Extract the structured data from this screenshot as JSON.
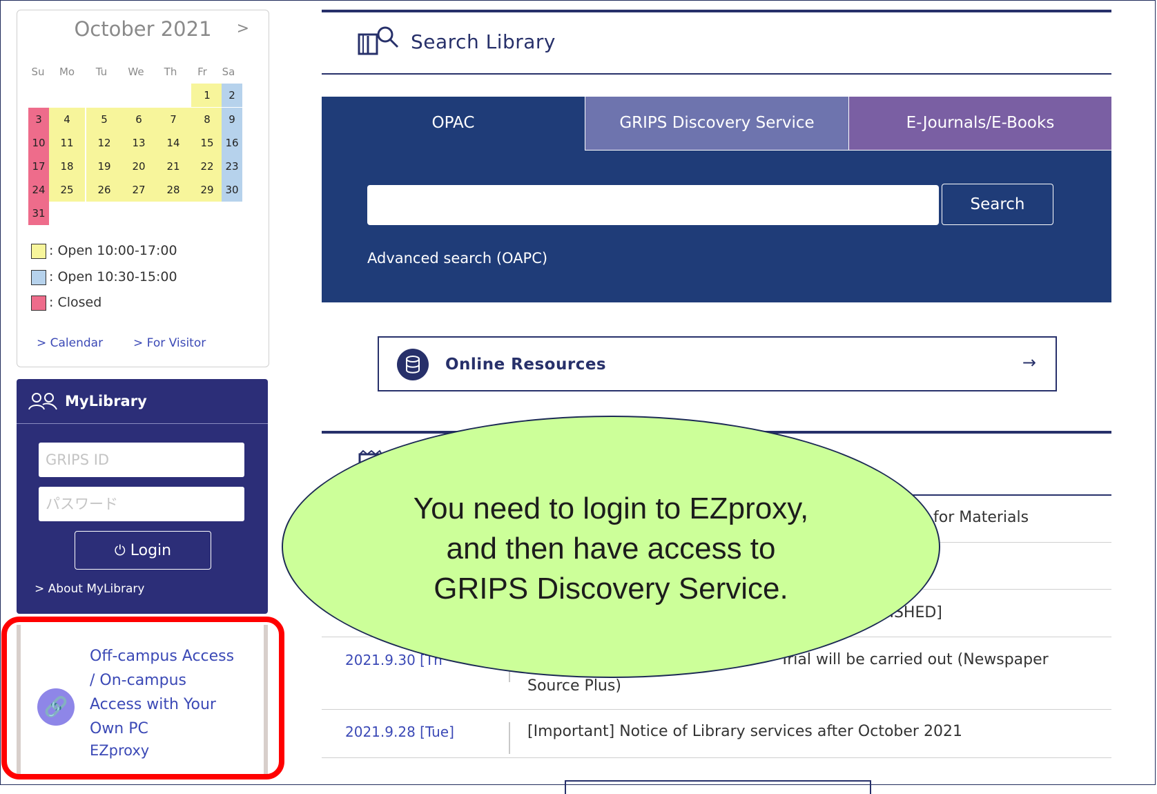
{
  "calendar": {
    "month_title": "October 2021",
    "next_label": ">",
    "weekdays": [
      "Su",
      "Mo",
      "Tu",
      "We",
      "Th",
      "Fr",
      "Sa"
    ],
    "legend": [
      {
        "label": ": Open 10:00-17:00",
        "color": "#f7f59b"
      },
      {
        "label": ": Open 10:30-15:00",
        "color": "#b6d2ec"
      },
      {
        "label": ": Closed",
        "color": "#ee6c8b"
      }
    ],
    "links": [
      "> Calendar",
      "> For Visitor"
    ],
    "days": [
      {
        "d": "1",
        "s": "y"
      },
      {
        "d": "2",
        "s": "b"
      },
      {
        "d": "3",
        "s": "r"
      },
      {
        "d": "4",
        "s": "y"
      },
      {
        "d": "5",
        "s": "y"
      },
      {
        "d": "6",
        "s": "y"
      },
      {
        "d": "7",
        "s": "y"
      },
      {
        "d": "8",
        "s": "y"
      },
      {
        "d": "9",
        "s": "b"
      },
      {
        "d": "10",
        "s": "r"
      },
      {
        "d": "11",
        "s": "y"
      },
      {
        "d": "12",
        "s": "y"
      },
      {
        "d": "13",
        "s": "y"
      },
      {
        "d": "14",
        "s": "y"
      },
      {
        "d": "15",
        "s": "y"
      },
      {
        "d": "16",
        "s": "b"
      },
      {
        "d": "17",
        "s": "r"
      },
      {
        "d": "18",
        "s": "y"
      },
      {
        "d": "19",
        "s": "y"
      },
      {
        "d": "20",
        "s": "y"
      },
      {
        "d": "21",
        "s": "y"
      },
      {
        "d": "22",
        "s": "y"
      },
      {
        "d": "23",
        "s": "b"
      },
      {
        "d": "24",
        "s": "r"
      },
      {
        "d": "25",
        "s": "y"
      },
      {
        "d": "26",
        "s": "y"
      },
      {
        "d": "27",
        "s": "y"
      },
      {
        "d": "28",
        "s": "y"
      },
      {
        "d": "29",
        "s": "y"
      },
      {
        "d": "30",
        "s": "b"
      },
      {
        "d": "31",
        "s": "r"
      }
    ]
  },
  "mylibrary": {
    "title": "MyLibrary",
    "id_placeholder": "GRIPS ID",
    "password_placeholder": "パスワード",
    "login_label": "Login",
    "about_link": "> About MyLibrary"
  },
  "offcampus": {
    "lines": [
      "Off-campus Access",
      "/ On-campus",
      "Access with Your",
      "Own PC"
    ],
    "ezproxy": "EZproxy"
  },
  "search_library": {
    "title": "Search Library",
    "tabs": [
      "OPAC",
      "GRIPS Discovery Service",
      "E-Journals/E-Books"
    ],
    "search_button": "Search",
    "advanced_link": "Advanced search (OAPC)"
  },
  "online_resources": {
    "label": "Online Resources",
    "arrow": "→"
  },
  "news": {
    "row1_fragment": "for Materials",
    "row3_fragment": "NISHED]",
    "row4_date_fragment": "2021.9.30 [Th",
    "row4_text": "Trial will be carried out (Newspaper",
    "row4_text2": "Source Plus)",
    "row5_date": "2021.9.28 [Tue]",
    "row5_text": "[Important] Notice of Library services after October 2021"
  },
  "callout": {
    "lines": [
      "You need to login to EZproxy,",
      "and then have access to",
      "GRIPS Discovery Service."
    ],
    "fill_color": "#ccff99"
  },
  "highlight_color": "#ff0000"
}
